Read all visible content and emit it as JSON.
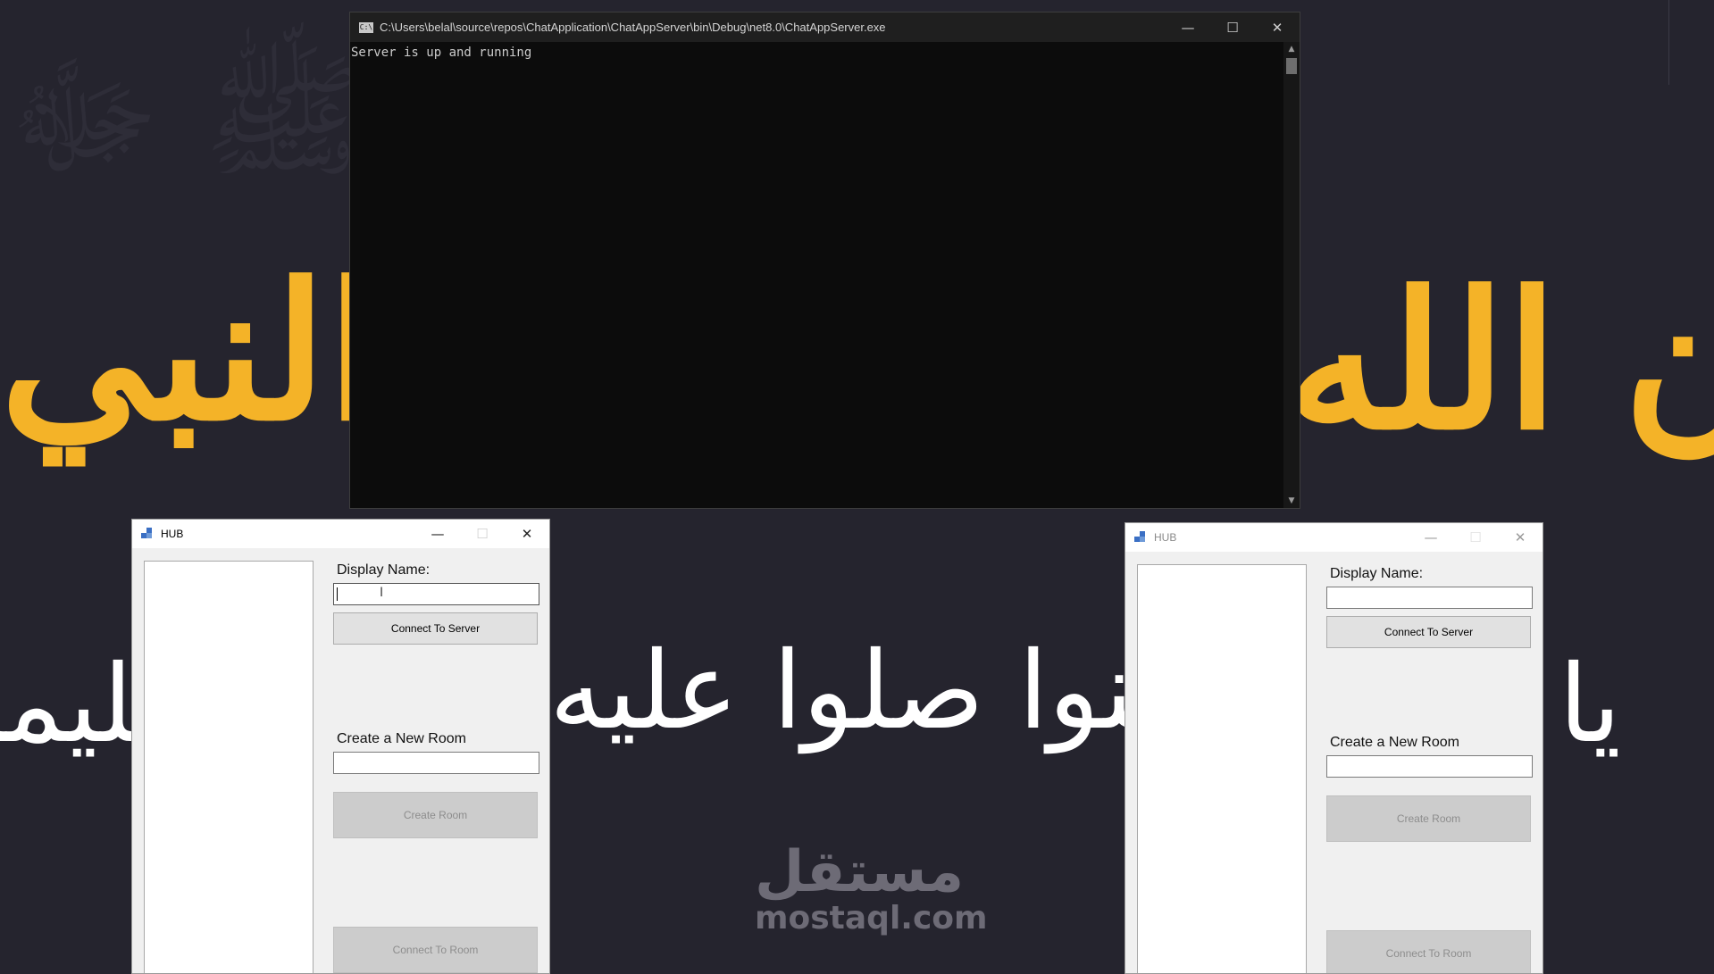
{
  "console": {
    "title": "C:\\Users\\belal\\source\\repos\\ChatApplication\\ChatAppServer\\bin\\Debug\\net8.0\\ChatAppServer.exe",
    "icon": "cmd-icon",
    "output": "Server is up and running"
  },
  "hub_left": {
    "title": "HUB",
    "display_name_label": "Display Name:",
    "display_name_value": "",
    "connect_server_label": "Connect To Server",
    "create_room_label": "Create a New Room",
    "new_room_value": "",
    "create_room_button": "Create Room",
    "connect_room_button": "Connect To Room"
  },
  "hub_right": {
    "title": "HUB",
    "display_name_label": "Display Name:",
    "display_name_value": "",
    "connect_server_label": "Connect To Server",
    "create_room_label": "Create a New Room",
    "new_room_value": "",
    "create_room_button": "Create Room",
    "connect_room_button": "Connect To Room"
  },
  "wallpaper": {
    "calligraphy_gold_left": "على النبي",
    "calligraphy_gold_right": "إن الله",
    "calligraphy_white_mid": "آمنوا صلوا عليه",
    "calligraphy_white_right": "يا",
    "calligraphy_white_left": "تسليما",
    "watermark_arabic": "مستقل",
    "watermark_latin": "mostaql.com"
  },
  "colors": {
    "desktop": "#25242e",
    "gold": "#f4b328",
    "console_bg": "#0c0c0c",
    "form_bg": "#f0f0f0"
  }
}
